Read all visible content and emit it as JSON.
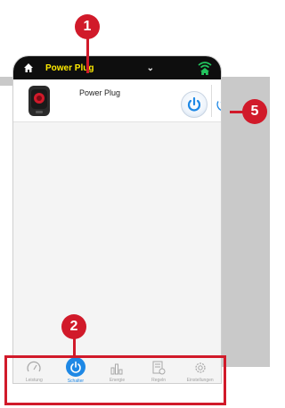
{
  "appbar": {
    "device_select_value": "Power Plug"
  },
  "device_card": {
    "name": "Power Plug"
  },
  "bottom_nav": {
    "items": [
      {
        "label": "Leistung",
        "icon": "gauge-icon"
      },
      {
        "label": "Schalter",
        "icon": "power-icon"
      },
      {
        "label": "Energie",
        "icon": "bar-chart-icon"
      },
      {
        "label": "Regeln",
        "icon": "rules-icon"
      },
      {
        "label": "Einstellungen",
        "icon": "gear-icon"
      }
    ],
    "active_index": 1
  },
  "callouts": {
    "c1": "1",
    "c2": "2",
    "c5": "5"
  },
  "colors": {
    "appbar_bg": "#0e0e0e",
    "appbar_text": "#ffeb00",
    "accent_blue": "#1e88e5",
    "callout_red": "#d11a2a",
    "wifi_green": "#22c55e"
  }
}
